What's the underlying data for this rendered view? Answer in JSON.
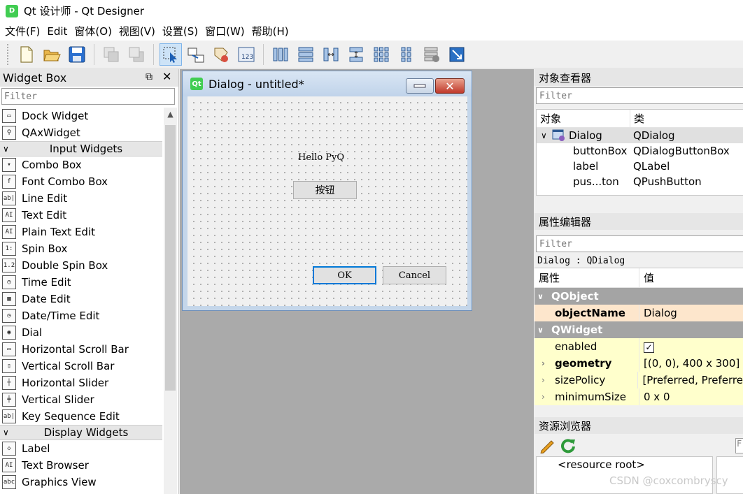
{
  "window": {
    "title": "Qt 设计师 - Qt Designer",
    "app_icon": "qt-icon"
  },
  "menubar": [
    "文件(F)",
    "Edit",
    "窗体(O)",
    "视图(V)",
    "设置(S)",
    "窗口(W)",
    "帮助(H)"
  ],
  "widget_box": {
    "title": "Widget Box",
    "filter_placeholder": "Filter",
    "items": [
      {
        "type": "item",
        "label": "Dock Widget",
        "icon": "dock-widget-icon",
        "glyph": "▭"
      },
      {
        "type": "item",
        "label": "QAxWidget",
        "icon": "qaxwidget-icon",
        "glyph": "⚲"
      },
      {
        "type": "category",
        "label": "Input Widgets"
      },
      {
        "type": "item",
        "label": "Combo Box",
        "icon": "combo-box-icon",
        "glyph": "▾"
      },
      {
        "type": "item",
        "label": "Font Combo Box",
        "icon": "font-combo-box-icon",
        "glyph": "f"
      },
      {
        "type": "item",
        "label": "Line Edit",
        "icon": "line-edit-icon",
        "glyph": "ab|"
      },
      {
        "type": "item",
        "label": "Text Edit",
        "icon": "text-edit-icon",
        "glyph": "AI"
      },
      {
        "type": "item",
        "label": "Plain Text Edit",
        "icon": "plain-text-edit-icon",
        "glyph": "AI"
      },
      {
        "type": "item",
        "label": "Spin Box",
        "icon": "spin-box-icon",
        "glyph": "1:"
      },
      {
        "type": "item",
        "label": "Double Spin Box",
        "icon": "double-spin-box-icon",
        "glyph": "1.2"
      },
      {
        "type": "item",
        "label": "Time Edit",
        "icon": "time-edit-icon",
        "glyph": "◷"
      },
      {
        "type": "item",
        "label": "Date Edit",
        "icon": "date-edit-icon",
        "glyph": "▦"
      },
      {
        "type": "item",
        "label": "Date/Time Edit",
        "icon": "date-time-edit-icon",
        "glyph": "◷"
      },
      {
        "type": "item",
        "label": "Dial",
        "icon": "dial-icon",
        "glyph": "◉"
      },
      {
        "type": "item",
        "label": "Horizontal Scroll Bar",
        "icon": "horizontal-scroll-bar-icon",
        "glyph": "▭"
      },
      {
        "type": "item",
        "label": "Vertical Scroll Bar",
        "icon": "vertical-scroll-bar-icon",
        "glyph": "▯"
      },
      {
        "type": "item",
        "label": "Horizontal Slider",
        "icon": "horizontal-slider-icon",
        "glyph": "┼"
      },
      {
        "type": "item",
        "label": "Vertical Slider",
        "icon": "vertical-slider-icon",
        "glyph": "╪"
      },
      {
        "type": "item",
        "label": "Key Sequence Edit",
        "icon": "key-sequence-edit-icon",
        "glyph": "ab|"
      },
      {
        "type": "category",
        "label": "Display Widgets"
      },
      {
        "type": "item",
        "label": "Label",
        "icon": "label-icon",
        "glyph": "◇"
      },
      {
        "type": "item",
        "label": "Text Browser",
        "icon": "text-browser-icon",
        "glyph": "AI"
      },
      {
        "type": "item",
        "label": "Graphics View",
        "icon": "graphics-view-icon",
        "glyph": "abc"
      }
    ]
  },
  "dialog": {
    "title": "Dialog - untitled*",
    "label_text": "Hello PyQ",
    "push_button": "按钮",
    "ok": "OK",
    "cancel": "Cancel"
  },
  "object_inspector": {
    "title": "对象查看器",
    "filter_placeholder": "Filter",
    "col_object": "对象",
    "col_class": "类",
    "rows": [
      {
        "object": "Dialog",
        "class": "QDialog"
      },
      {
        "object": "buttonBox",
        "class": "QDialogButtonBox"
      },
      {
        "object": "label",
        "class": "QLabel"
      },
      {
        "object": "pus...ton",
        "class": "QPushButton"
      }
    ]
  },
  "property_editor": {
    "title": "属性编辑器",
    "filter_placeholder": "Filter",
    "class_line": "Dialog : QDialog",
    "col_property": "属性",
    "col_value": "值",
    "groups": [
      {
        "name": "QObject",
        "rows": [
          {
            "name": "objectName",
            "value": "Dialog",
            "bold": true,
            "expandable": false
          }
        ]
      },
      {
        "name": "QWidget",
        "rows": [
          {
            "name": "enabled",
            "value": "✓",
            "bold": false,
            "expandable": false
          },
          {
            "name": "geometry",
            "value": "[(0, 0), 400 x 300]",
            "bold": true,
            "expandable": true
          },
          {
            "name": "sizePolicy",
            "value": "[Preferred, Preferre",
            "bold": false,
            "expandable": true
          },
          {
            "name": "minimumSize",
            "value": "0 x 0",
            "bold": false,
            "expandable": true
          }
        ]
      }
    ]
  },
  "resource_browser": {
    "title": "资源浏览器",
    "root": "<resource root>",
    "filter_fragment": "F"
  },
  "watermark": "CSDN @coxcombryscy"
}
